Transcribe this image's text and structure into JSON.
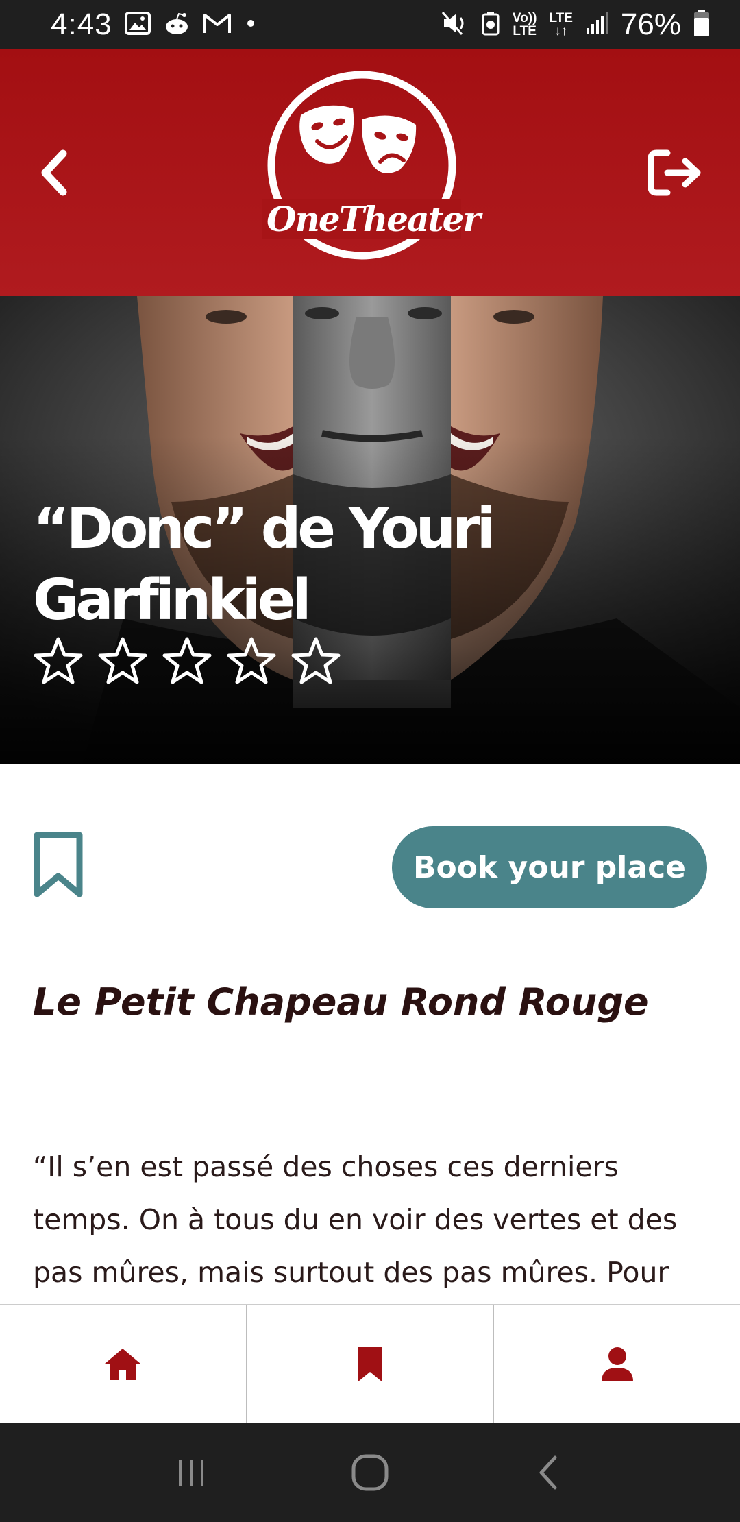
{
  "status_bar": {
    "time": "4:43",
    "volte_top": "Vo))",
    "volte_bottom": "LTE",
    "lte_label": "LTE",
    "battery_percent": "76%",
    "icons": [
      "gallery-icon",
      "reddit-icon",
      "gmail-icon",
      "dot-icon",
      "mute-icon",
      "battery-saver-icon",
      "volte-icon",
      "lte-icon",
      "signal-icon",
      "battery-icon"
    ]
  },
  "header": {
    "logo_text": "OneTheater",
    "back_icon": "chevron-left-icon",
    "logout_icon": "logout-icon"
  },
  "hero": {
    "title": "“Donc” de Youri Garfinkiel",
    "rating": 0,
    "rating_max": 5
  },
  "actions": {
    "bookmark_icon": "bookmark-outline-icon",
    "book_label": "Book your place"
  },
  "venue": "Le Petit Chapeau Rond Rouge",
  "description": "“Il s’en est passé des choses ces derniers temps. On à tous du en voir des vertes et des pas mûres, mais surtout des pas mûres. Pour",
  "bottom_nav": [
    {
      "icon": "home-icon"
    },
    {
      "icon": "bookmark-icon"
    },
    {
      "icon": "user-icon"
    }
  ],
  "colors": {
    "brand_red": "#a30f12",
    "accent_teal": "#4a848a",
    "nav_icon": "#a01014"
  }
}
